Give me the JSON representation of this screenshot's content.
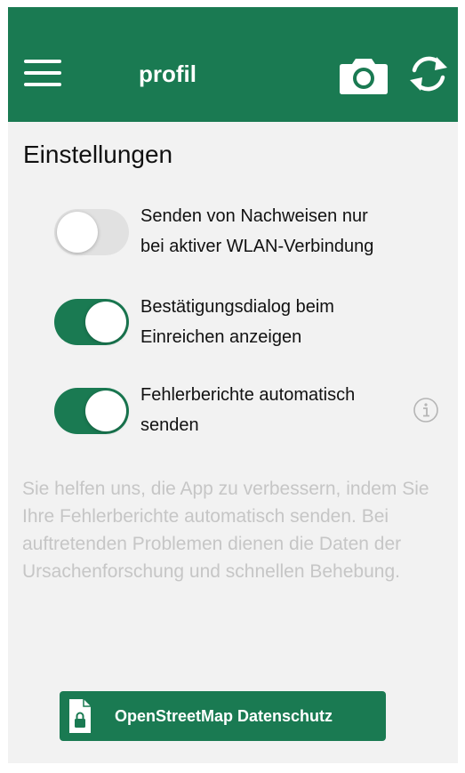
{
  "header": {
    "title": "profil",
    "menu_icon": "hamburger-menu-icon",
    "camera_icon": "camera-icon",
    "sync_icon": "sync-icon",
    "color": "#1a7a52"
  },
  "settings": {
    "title": "Einstellungen",
    "toggles": [
      {
        "line1": "Senden von Nachweisen nur",
        "line2": "bei aktiver WLAN-Verbindung",
        "state": "off"
      },
      {
        "line1": "Bestätigungsdialog beim",
        "line2": "Einreichen anzeigen",
        "state": "on"
      },
      {
        "line1": "Fehlerberichte automatisch",
        "line2": "senden",
        "state": "on"
      }
    ],
    "info_icon": "info-icon",
    "info_text": "Sie helfen uns, die App zu verbessern, indem Sie Ihre Fehlerberichte automatisch senden. Bei auftretenden Problemen dienen die Daten der Ursachenforschung und schnellen Behebung."
  },
  "privacy_button": {
    "label": "OpenStreetMap Datenschutz",
    "icon": "document-lock-icon"
  }
}
